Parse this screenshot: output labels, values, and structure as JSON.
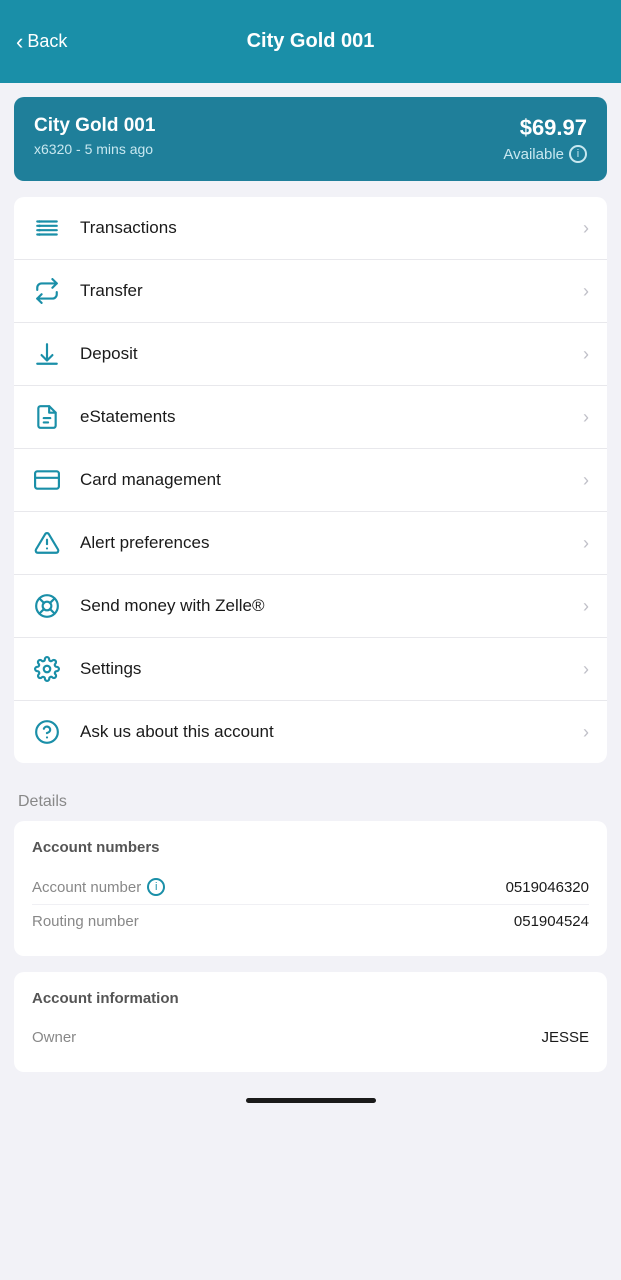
{
  "header": {
    "back_label": "Back",
    "title": "City Gold 001"
  },
  "account_card": {
    "name": "City Gold 001",
    "subtitle": "x6320 - 5 mins ago",
    "balance": "$69.97",
    "available_label": "Available"
  },
  "menu": {
    "items": [
      {
        "id": "transactions",
        "label": "Transactions",
        "icon": "list"
      },
      {
        "id": "transfer",
        "label": "Transfer",
        "icon": "transfer"
      },
      {
        "id": "deposit",
        "label": "Deposit",
        "icon": "deposit"
      },
      {
        "id": "estatements",
        "label": "eStatements",
        "icon": "document"
      },
      {
        "id": "card-management",
        "label": "Card management",
        "icon": "card"
      },
      {
        "id": "alert-preferences",
        "label": "Alert preferences",
        "icon": "alert"
      },
      {
        "id": "zelle",
        "label": "Send money with Zelle®",
        "icon": "zelle"
      },
      {
        "id": "settings",
        "label": "Settings",
        "icon": "settings"
      },
      {
        "id": "ask",
        "label": "Ask us about this account",
        "icon": "help"
      }
    ]
  },
  "details": {
    "section_label": "Details",
    "account_numbers": {
      "title": "Account numbers",
      "rows": [
        {
          "label": "Account number",
          "value": "0519046320",
          "has_info": true
        },
        {
          "label": "Routing number",
          "value": "051904524",
          "has_info": false
        }
      ]
    },
    "account_information": {
      "title": "Account information",
      "rows": [
        {
          "label": "Owner",
          "value": "JESSE"
        }
      ]
    }
  },
  "colors": {
    "primary": "#1a8fa8",
    "card_bg": "#1f7f9a",
    "icon_color": "#1a8fa8"
  }
}
